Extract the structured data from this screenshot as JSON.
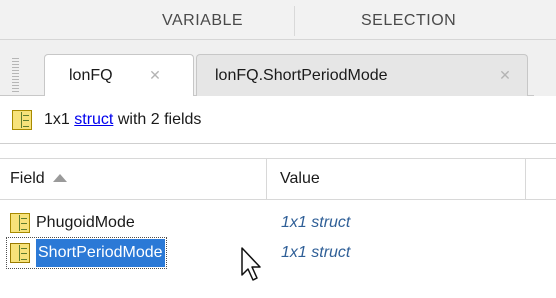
{
  "header": {
    "section_variable": "VARIABLE",
    "section_selection": "SELECTION"
  },
  "tabs": [
    {
      "label": "lonFQ",
      "active": true
    },
    {
      "label": "lonFQ.ShortPeriodMode",
      "active": false
    }
  ],
  "info_bar": {
    "prefix": "1x1",
    "link": "struct",
    "suffix": "with 2 fields"
  },
  "table": {
    "columns": {
      "field": "Field",
      "value": "Value"
    },
    "rows": [
      {
        "field": "PhugoidMode",
        "value": "1x1 struct",
        "selected": false
      },
      {
        "field": "ShortPeriodMode",
        "value": "1x1 struct",
        "selected": true
      }
    ]
  },
  "colors": {
    "selection": "#2b79d6",
    "link": "#0000ee",
    "value_text": "#2f5f97",
    "icon_fill": "#f7e27a"
  },
  "icons": {
    "struct": "struct-icon",
    "close": "close-icon",
    "sort": "sort-ascending-icon",
    "cursor": "mouse-pointer-icon"
  }
}
